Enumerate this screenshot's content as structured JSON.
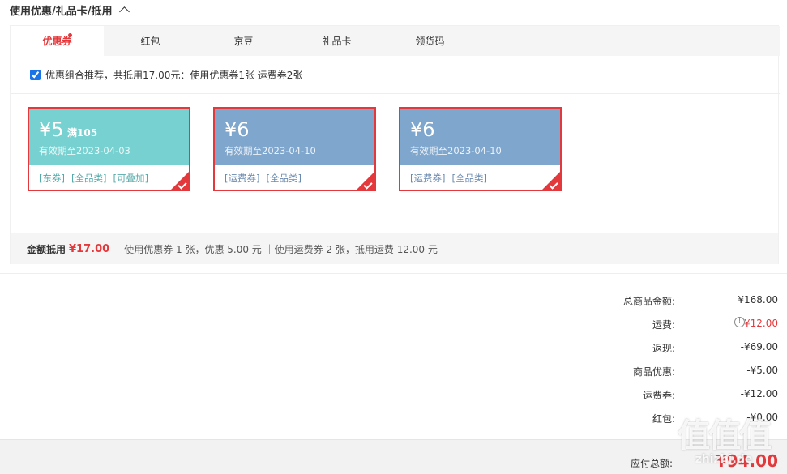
{
  "section": {
    "title": "使用优惠/礼品卡/抵用"
  },
  "tabs": [
    {
      "label": "优惠券",
      "active": true,
      "has_dot": true
    },
    {
      "label": "红包"
    },
    {
      "label": "京豆"
    },
    {
      "label": "礼品卡"
    },
    {
      "label": "领货码"
    }
  ],
  "combo": {
    "checked": true,
    "text": "优惠组合推荐，共抵用17.00元：使用优惠券1张 运费券2张"
  },
  "coupons": [
    {
      "amount": "¥5",
      "condition": "满105",
      "valid": "有效期至2023-04-03",
      "tags": [
        "[东券]",
        "[全品类]",
        "[可叠加]"
      ],
      "color": "#76d1d0"
    },
    {
      "amount": "¥6",
      "condition": "",
      "valid": "有效期至2023-04-10",
      "tags": [
        "[运费券]",
        "[全品类]"
      ],
      "color": "#7fa6cc"
    },
    {
      "amount": "¥6",
      "condition": "",
      "valid": "有效期至2023-04-10",
      "tags": [
        "[运费券]",
        "[全品类]"
      ],
      "color": "#7fa6cc"
    }
  ],
  "summary": {
    "label": "金额抵用",
    "amount": "¥17.00",
    "desc": "使用优惠券 1 张，优惠 5.00 元 ｜使用运费券 2 张，抵用运费 12.00 元"
  },
  "totals": [
    {
      "label": "总商品金额:",
      "value": "¥168.00"
    },
    {
      "label": "运费:",
      "value": "¥12.00",
      "red": true,
      "info": true
    },
    {
      "label": "返现:",
      "value": "-¥69.00"
    },
    {
      "label": "商品优惠:",
      "value": "-¥5.00"
    },
    {
      "label": "运费券:",
      "value": "-¥12.00"
    },
    {
      "label": "红包:",
      "value": "-¥0.00"
    }
  ],
  "payable": {
    "label": "应付总额:",
    "value": "¥94.00"
  },
  "watermark": {
    "main": "值值值",
    "sub": "zhizhi.de"
  },
  "colors": {
    "accent": "#e4393c",
    "teal": "#76d1d0",
    "blue": "#7fa6cc"
  }
}
